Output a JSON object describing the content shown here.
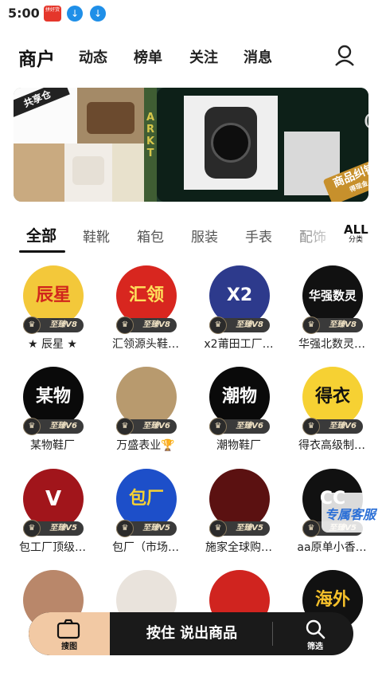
{
  "status_bar": {
    "time": "5:00",
    "app_label": "拼好货"
  },
  "top_nav": {
    "items": [
      {
        "label": "商户",
        "active": true
      },
      {
        "label": "动态"
      },
      {
        "label": "榜单"
      },
      {
        "label": "关注"
      },
      {
        "label": "消息"
      }
    ],
    "user_icon": "user-icon"
  },
  "banner": {
    "left_text": "共享仓",
    "middle_text": "ARKT",
    "right_badge": "商品纠错",
    "right_badge_sub": "得现金",
    "right_letter": "C"
  },
  "categories": {
    "tabs": [
      "全部",
      "鞋靴",
      "箱包",
      "服装",
      "手表",
      "配饰"
    ],
    "active": "全部",
    "all_main": "ALL",
    "all_sub": "分类"
  },
  "merchants": [
    {
      "name": "★ 辰星 ★",
      "level": "至臻V8",
      "avatar_text": "辰星",
      "avatar_bg": "#f3c83a",
      "avatar_color": "#d1261c"
    },
    {
      "name": "汇领源头鞋…",
      "level": "至臻V8",
      "avatar_text": "汇领",
      "avatar_bg": "#d8261f",
      "avatar_color": "#ffe15c"
    },
    {
      "name": "x2莆田工厂…",
      "level": "至臻V8",
      "avatar_text": "X2",
      "avatar_bg": "#2d3a8c",
      "avatar_color": "#ffffff"
    },
    {
      "name": "华强北数灵…",
      "level": "至臻V8",
      "avatar_text": "华强数灵",
      "avatar_bg": "#111111",
      "avatar_color": "#ffffff"
    },
    {
      "name": "某物鞋厂",
      "level": "至臻V6",
      "avatar_text": "某物",
      "avatar_bg": "#0a0a0a",
      "avatar_color": "#ffffff"
    },
    {
      "name": "万盛表业🏆",
      "level": "至臻V6",
      "avatar_text": "",
      "avatar_bg": "#b89a6e",
      "avatar_color": "#ffffff"
    },
    {
      "name": "潮物鞋厂",
      "level": "至臻V6",
      "avatar_text": "潮物",
      "avatar_bg": "#0a0a0a",
      "avatar_color": "#ffffff"
    },
    {
      "name": "得衣高级制…",
      "level": "至臻V6",
      "avatar_text": "得衣",
      "avatar_bg": "#f6d133",
      "avatar_color": "#111111"
    },
    {
      "name": "包工厂顶级…",
      "level": "至臻V5",
      "avatar_text": "V",
      "avatar_bg": "#a1151b",
      "avatar_color": "#ffffff"
    },
    {
      "name": "包厂（市场…",
      "level": "至臻V5",
      "avatar_text": "包厂",
      "avatar_bg": "#1d4fc9",
      "avatar_color": "#f6d133"
    },
    {
      "name": "施家全球购…",
      "level": "至臻V5",
      "avatar_text": "",
      "avatar_bg": "#5b1111",
      "avatar_color": "#ffffff"
    },
    {
      "name": "aa原单小香…",
      "level": "至臻V5",
      "avatar_text": "CC",
      "avatar_bg": "#111111",
      "avatar_color": "#ffffff"
    },
    {
      "name": "",
      "level": "",
      "avatar_text": "",
      "avatar_bg": "#b9876a",
      "avatar_color": "#ffffff"
    },
    {
      "name": "",
      "level": "",
      "avatar_text": "",
      "avatar_bg": "#e9e3dc",
      "avatar_color": "#ffffff"
    },
    {
      "name": "",
      "level": "",
      "avatar_text": "",
      "avatar_bg": "#d0241f",
      "avatar_color": "#ffffff"
    },
    {
      "name": "",
      "level": "",
      "avatar_text": "海外",
      "avatar_bg": "#111111",
      "avatar_color": "#f6c12b"
    }
  ],
  "float_service": {
    "label": "专属客服"
  },
  "bottom_bar": {
    "search_label": "搜图",
    "voice_label": "按住 说出商品",
    "filter_label": "筛选"
  },
  "colors": {
    "accent": "#f2c9a4",
    "badge": "#3a3a3a",
    "bar": "#1a1a1a"
  }
}
